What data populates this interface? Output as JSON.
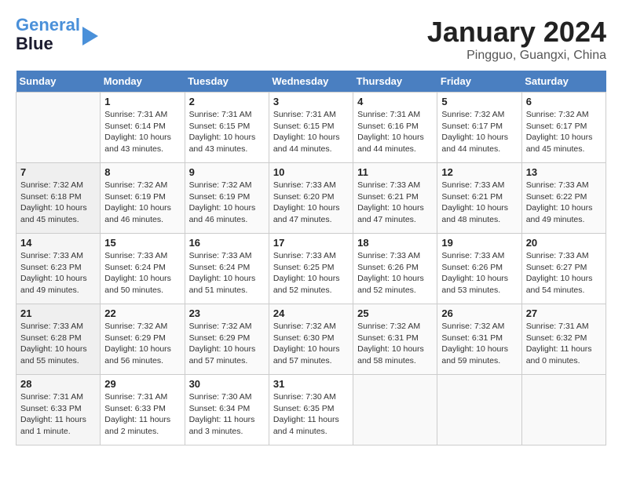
{
  "header": {
    "logo_line1": "General",
    "logo_line2": "Blue",
    "title": "January 2024",
    "subtitle": "Pingguo, Guangxi, China"
  },
  "days_of_week": [
    "Sunday",
    "Monday",
    "Tuesday",
    "Wednesday",
    "Thursday",
    "Friday",
    "Saturday"
  ],
  "weeks": [
    [
      {
        "num": "",
        "detail": ""
      },
      {
        "num": "1",
        "detail": "Sunrise: 7:31 AM\nSunset: 6:14 PM\nDaylight: 10 hours\nand 43 minutes."
      },
      {
        "num": "2",
        "detail": "Sunrise: 7:31 AM\nSunset: 6:15 PM\nDaylight: 10 hours\nand 43 minutes."
      },
      {
        "num": "3",
        "detail": "Sunrise: 7:31 AM\nSunset: 6:15 PM\nDaylight: 10 hours\nand 44 minutes."
      },
      {
        "num": "4",
        "detail": "Sunrise: 7:31 AM\nSunset: 6:16 PM\nDaylight: 10 hours\nand 44 minutes."
      },
      {
        "num": "5",
        "detail": "Sunrise: 7:32 AM\nSunset: 6:17 PM\nDaylight: 10 hours\nand 44 minutes."
      },
      {
        "num": "6",
        "detail": "Sunrise: 7:32 AM\nSunset: 6:17 PM\nDaylight: 10 hours\nand 45 minutes."
      }
    ],
    [
      {
        "num": "7",
        "detail": "Sunrise: 7:32 AM\nSunset: 6:18 PM\nDaylight: 10 hours\nand 45 minutes."
      },
      {
        "num": "8",
        "detail": "Sunrise: 7:32 AM\nSunset: 6:19 PM\nDaylight: 10 hours\nand 46 minutes."
      },
      {
        "num": "9",
        "detail": "Sunrise: 7:32 AM\nSunset: 6:19 PM\nDaylight: 10 hours\nand 46 minutes."
      },
      {
        "num": "10",
        "detail": "Sunrise: 7:33 AM\nSunset: 6:20 PM\nDaylight: 10 hours\nand 47 minutes."
      },
      {
        "num": "11",
        "detail": "Sunrise: 7:33 AM\nSunset: 6:21 PM\nDaylight: 10 hours\nand 47 minutes."
      },
      {
        "num": "12",
        "detail": "Sunrise: 7:33 AM\nSunset: 6:21 PM\nDaylight: 10 hours\nand 48 minutes."
      },
      {
        "num": "13",
        "detail": "Sunrise: 7:33 AM\nSunset: 6:22 PM\nDaylight: 10 hours\nand 49 minutes."
      }
    ],
    [
      {
        "num": "14",
        "detail": "Sunrise: 7:33 AM\nSunset: 6:23 PM\nDaylight: 10 hours\nand 49 minutes."
      },
      {
        "num": "15",
        "detail": "Sunrise: 7:33 AM\nSunset: 6:24 PM\nDaylight: 10 hours\nand 50 minutes."
      },
      {
        "num": "16",
        "detail": "Sunrise: 7:33 AM\nSunset: 6:24 PM\nDaylight: 10 hours\nand 51 minutes."
      },
      {
        "num": "17",
        "detail": "Sunrise: 7:33 AM\nSunset: 6:25 PM\nDaylight: 10 hours\nand 52 minutes."
      },
      {
        "num": "18",
        "detail": "Sunrise: 7:33 AM\nSunset: 6:26 PM\nDaylight: 10 hours\nand 52 minutes."
      },
      {
        "num": "19",
        "detail": "Sunrise: 7:33 AM\nSunset: 6:26 PM\nDaylight: 10 hours\nand 53 minutes."
      },
      {
        "num": "20",
        "detail": "Sunrise: 7:33 AM\nSunset: 6:27 PM\nDaylight: 10 hours\nand 54 minutes."
      }
    ],
    [
      {
        "num": "21",
        "detail": "Sunrise: 7:33 AM\nSunset: 6:28 PM\nDaylight: 10 hours\nand 55 minutes."
      },
      {
        "num": "22",
        "detail": "Sunrise: 7:32 AM\nSunset: 6:29 PM\nDaylight: 10 hours\nand 56 minutes."
      },
      {
        "num": "23",
        "detail": "Sunrise: 7:32 AM\nSunset: 6:29 PM\nDaylight: 10 hours\nand 57 minutes."
      },
      {
        "num": "24",
        "detail": "Sunrise: 7:32 AM\nSunset: 6:30 PM\nDaylight: 10 hours\nand 57 minutes."
      },
      {
        "num": "25",
        "detail": "Sunrise: 7:32 AM\nSunset: 6:31 PM\nDaylight: 10 hours\nand 58 minutes."
      },
      {
        "num": "26",
        "detail": "Sunrise: 7:32 AM\nSunset: 6:31 PM\nDaylight: 10 hours\nand 59 minutes."
      },
      {
        "num": "27",
        "detail": "Sunrise: 7:31 AM\nSunset: 6:32 PM\nDaylight: 11 hours\nand 0 minutes."
      }
    ],
    [
      {
        "num": "28",
        "detail": "Sunrise: 7:31 AM\nSunset: 6:33 PM\nDaylight: 11 hours\nand 1 minute."
      },
      {
        "num": "29",
        "detail": "Sunrise: 7:31 AM\nSunset: 6:33 PM\nDaylight: 11 hours\nand 2 minutes."
      },
      {
        "num": "30",
        "detail": "Sunrise: 7:30 AM\nSunset: 6:34 PM\nDaylight: 11 hours\nand 3 minutes."
      },
      {
        "num": "31",
        "detail": "Sunrise: 7:30 AM\nSunset: 6:35 PM\nDaylight: 11 hours\nand 4 minutes."
      },
      {
        "num": "",
        "detail": ""
      },
      {
        "num": "",
        "detail": ""
      },
      {
        "num": "",
        "detail": ""
      }
    ]
  ]
}
